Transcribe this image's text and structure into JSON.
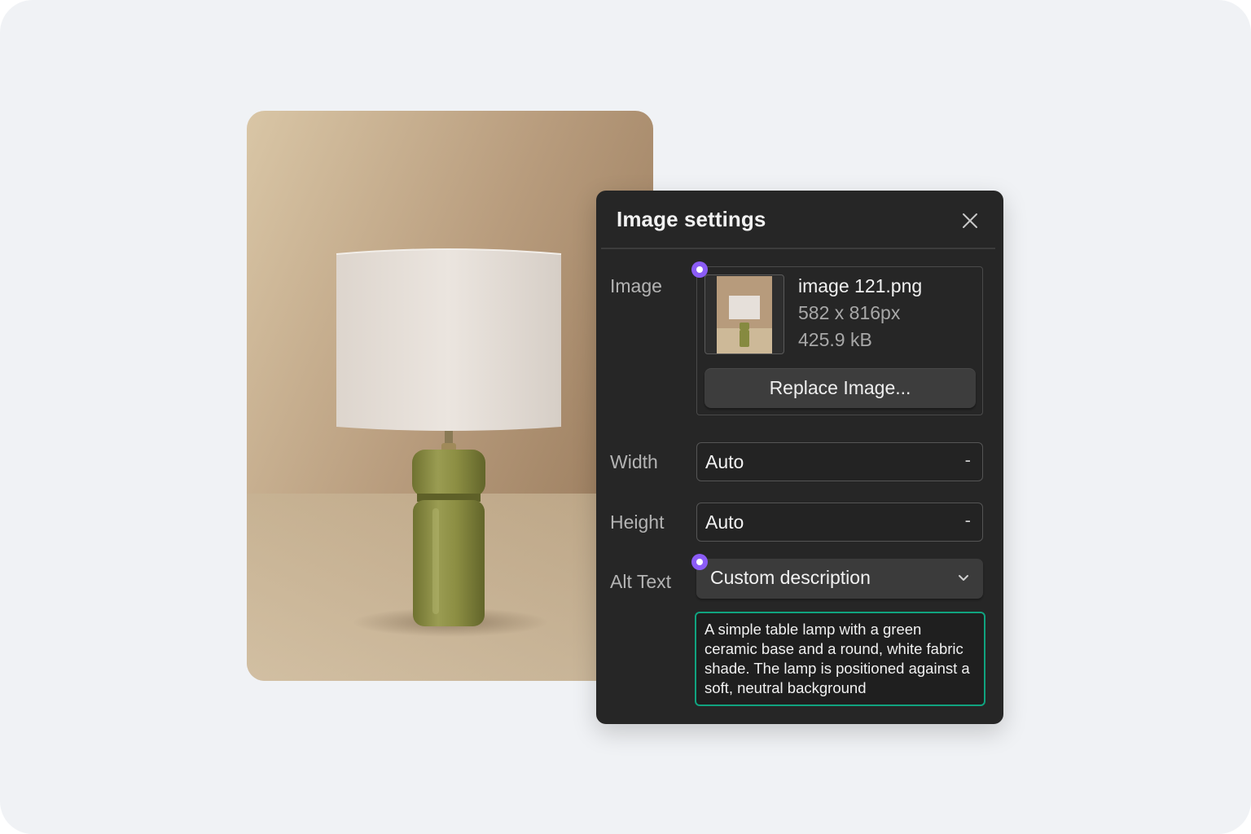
{
  "photo": {
    "alt": "A simple table lamp with a green ceramic base and a round, white fabric shade",
    "colors": {
      "background_light": "#d9c6a6",
      "background_dark": "#9c7e5f",
      "shade": "#e6e0da",
      "base": "#8c8e43"
    }
  },
  "panel": {
    "title": "Image settings",
    "close_icon": "close-icon",
    "image": {
      "label": "Image",
      "file_name": "image 121.png",
      "dimensions": "582 x 816px",
      "file_size": "425.9 kB",
      "replace_label": "Replace Image..."
    },
    "width": {
      "label": "Width",
      "value": "Auto",
      "suffix": "-"
    },
    "height": {
      "label": "Height",
      "value": "Auto",
      "suffix": "-"
    },
    "alt_text": {
      "label": "Alt Text",
      "mode": "Custom description",
      "value": "A simple table lamp with a green ceramic base and a round, white fabric shade. The lamp is positioned against a soft, neutral background"
    }
  },
  "colors": {
    "page_background": "#f0f2f5",
    "panel_background": "#262626",
    "accent_dot": "#8b5cf6",
    "focus_border": "#10a37f"
  }
}
